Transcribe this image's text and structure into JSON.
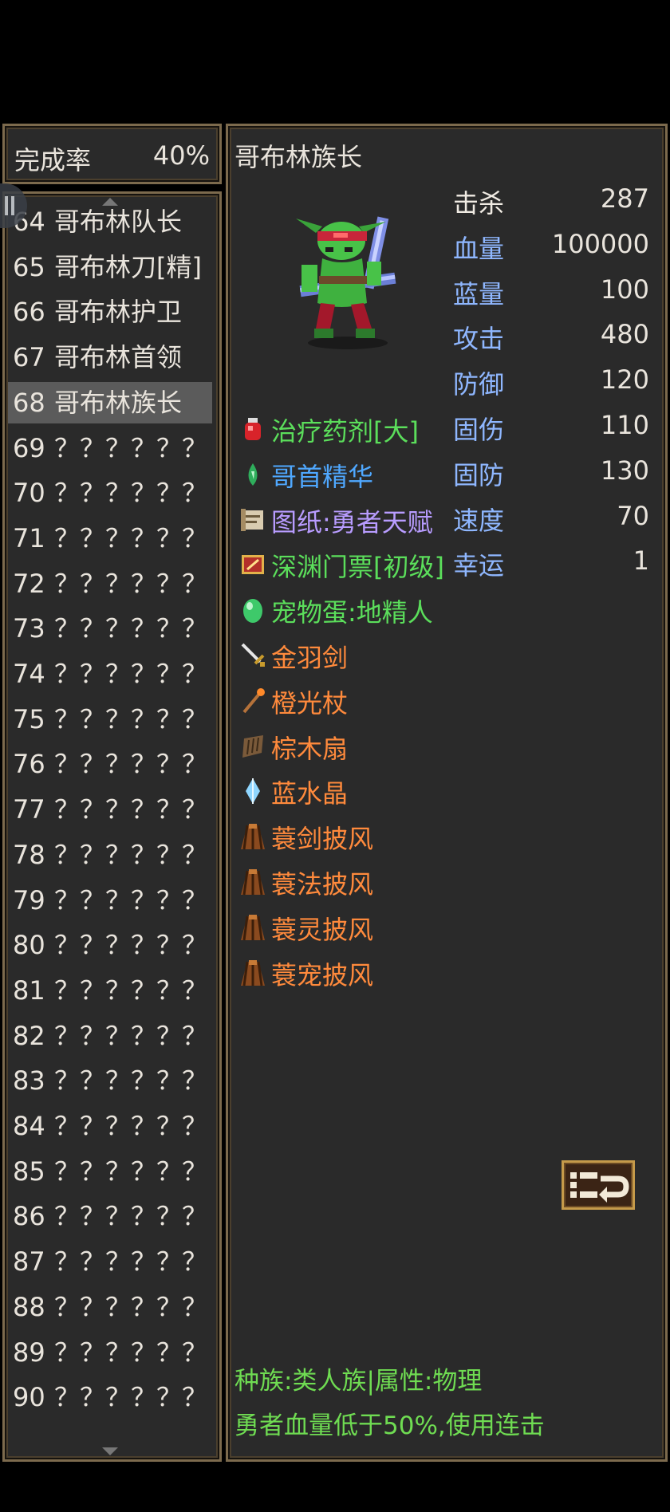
{
  "completion": {
    "label": "完成率",
    "value": "40%"
  },
  "list": {
    "items": [
      {
        "num": "64",
        "name": "哥布林队长"
      },
      {
        "num": "65",
        "name": "哥布林刀[精]"
      },
      {
        "num": "66",
        "name": "哥布林护卫"
      },
      {
        "num": "67",
        "name": "哥布林首领"
      },
      {
        "num": "68",
        "name": "哥布林族长"
      },
      {
        "num": "69",
        "name": "？？？？？？"
      },
      {
        "num": "70",
        "name": "？？？？？？"
      },
      {
        "num": "71",
        "name": "？？？？？？"
      },
      {
        "num": "72",
        "name": "？？？？？？"
      },
      {
        "num": "73",
        "name": "？？？？？？"
      },
      {
        "num": "74",
        "name": "？？？？？？"
      },
      {
        "num": "75",
        "name": "？？？？？？"
      },
      {
        "num": "76",
        "name": "？？？？？？"
      },
      {
        "num": "77",
        "name": "？？？？？？"
      },
      {
        "num": "78",
        "name": "？？？？？？"
      },
      {
        "num": "79",
        "name": "？？？？？？"
      },
      {
        "num": "80",
        "name": "？？？？？？"
      },
      {
        "num": "81",
        "name": "？？？？？？"
      },
      {
        "num": "82",
        "name": "？？？？？？"
      },
      {
        "num": "83",
        "name": "？？？？？？"
      },
      {
        "num": "84",
        "name": "？？？？？？"
      },
      {
        "num": "85",
        "name": "？？？？？？"
      },
      {
        "num": "86",
        "name": "？？？？？？"
      },
      {
        "num": "87",
        "name": "？？？？？？"
      },
      {
        "num": "88",
        "name": "？？？？？？"
      },
      {
        "num": "89",
        "name": "？？？？？？"
      },
      {
        "num": "90",
        "name": "？？？？？？"
      }
    ],
    "selected_index": 4
  },
  "detail": {
    "name": "哥布林族长",
    "stats": [
      {
        "label": "击杀",
        "value": "287"
      },
      {
        "label": "血量",
        "value": "100000"
      },
      {
        "label": "蓝量",
        "value": "100"
      },
      {
        "label": "攻击",
        "value": "480"
      },
      {
        "label": "防御",
        "value": "120"
      },
      {
        "label": "固伤",
        "value": "110"
      },
      {
        "label": "固防",
        "value": "130"
      },
      {
        "label": "速度",
        "value": "70"
      },
      {
        "label": "幸运",
        "value": "1"
      }
    ],
    "drops": [
      {
        "name": "治疗药剂[大]",
        "icon": "potion-icon",
        "color": "#5bde5b"
      },
      {
        "name": "哥首精华",
        "icon": "essence-drop-icon",
        "color": "#4fa8ff"
      },
      {
        "name": "图纸:勇者天赋",
        "icon": "scroll-icon",
        "color": "#b89cff"
      },
      {
        "name": "深渊门票[初级]",
        "icon": "ticket-icon",
        "color": "#5bde5b"
      },
      {
        "name": "宠物蛋:地精人",
        "icon": "egg-icon",
        "color": "#5bde5b"
      },
      {
        "name": "金羽剑",
        "icon": "sword-icon",
        "color": "#ff8a3c"
      },
      {
        "name": "橙光杖",
        "icon": "staff-icon",
        "color": "#ff8a3c"
      },
      {
        "name": "棕木扇",
        "icon": "fan-icon",
        "color": "#ff8a3c"
      },
      {
        "name": "蓝水晶",
        "icon": "crystal-icon",
        "color": "#ff8a3c"
      },
      {
        "name": "蓑剑披风",
        "icon": "cloak-icon",
        "color": "#ff8a3c"
      },
      {
        "name": "蓑法披风",
        "icon": "cloak-icon",
        "color": "#ff8a3c"
      },
      {
        "name": "蓑灵披风",
        "icon": "cloak-icon",
        "color": "#ff8a3c"
      },
      {
        "name": "蓑宠披风",
        "icon": "cloak-icon",
        "color": "#ff8a3c"
      }
    ],
    "race_line": "种族:类人族|属性:物理",
    "behavior_line": "勇者血量低于50%,使用连击"
  },
  "colors": {
    "panel_bg": "#2a2a2a",
    "panel_border": "#7c6a4d",
    "stat_label": "#8fb7ff",
    "footer_text": "#6fdc52"
  }
}
